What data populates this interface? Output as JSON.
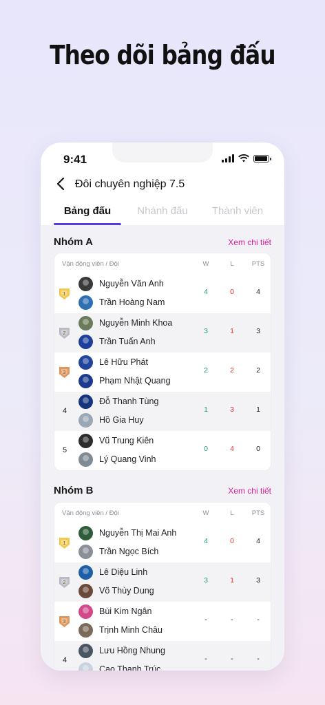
{
  "headline": "Theo dõi bảng đấu",
  "status": {
    "time": "9:41"
  },
  "nav": {
    "title": "Đôi chuyên nghiệp 7.5"
  },
  "tabs": [
    {
      "label": "Bảng đấu",
      "active": true
    },
    {
      "label": "Nhánh đấu",
      "active": false
    },
    {
      "label": "Thành viên",
      "active": false
    }
  ],
  "table_headers": {
    "player": "Vận động viên / Đội",
    "w": "W",
    "l": "L",
    "pts": "PTS"
  },
  "colors": {
    "accent": "#5b3ed8",
    "link": "#d6209a",
    "win": "#1f9c6b",
    "loss": "#e0352b",
    "gold": "#f2c94c",
    "silver": "#b9bcc4",
    "bronze": "#e0955a"
  },
  "groups": [
    {
      "title": "Nhóm A",
      "link": "Xem chi tiết",
      "rows": [
        {
          "rank": "1",
          "medal": "gold",
          "p1": "Nguyễn Văn Anh",
          "p2": "Trần Hoàng Nam",
          "w": "4",
          "l": "0",
          "pts": "4",
          "a1": "#3a3a3a",
          "a2": "#2f6fb3"
        },
        {
          "rank": "2",
          "medal": "silver",
          "p1": "Nguyễn Minh Khoa",
          "p2": "Trần Tuấn Anh",
          "w": "3",
          "l": "1",
          "pts": "3",
          "a1": "#6b7b5b",
          "a2": "#1d3f9a"
        },
        {
          "rank": "3",
          "medal": "bronze",
          "p1": "Lê Hữu Phát",
          "p2": "Phạm Nhật Quang",
          "w": "2",
          "l": "2",
          "pts": "2",
          "a1": "#22449a",
          "a2": "#1c3b8c"
        },
        {
          "rank": "4",
          "medal": "",
          "p1": "Đỗ Thanh Tùng",
          "p2": "Hồ Gia Huy",
          "w": "1",
          "l": "3",
          "pts": "1",
          "a1": "#15357d",
          "a2": "#9aa7b5"
        },
        {
          "rank": "5",
          "medal": "",
          "p1": "Vũ Trung Kiên",
          "p2": "Lý Quang Vinh",
          "w": "0",
          "l": "4",
          "pts": "0",
          "a1": "#2c2c2c",
          "a2": "#7e8a94"
        }
      ]
    },
    {
      "title": "Nhóm B",
      "link": "Xem chi tiết",
      "rows": [
        {
          "rank": "1",
          "medal": "gold",
          "p1": "Nguyễn Thị Mai Anh",
          "p2": "Trần Ngọc Bích",
          "w": "4",
          "l": "0",
          "pts": "4",
          "a1": "#2f5d3a",
          "a2": "#8b8f98"
        },
        {
          "rank": "2",
          "medal": "silver",
          "p1": "Lê Diệu Linh",
          "p2": "Võ Thùy Dung",
          "w": "3",
          "l": "1",
          "pts": "3",
          "a1": "#1e5fa8",
          "a2": "#6a4a3a"
        },
        {
          "rank": "3",
          "medal": "bronze",
          "p1": "Bùi Kim Ngân",
          "p2": "Trịnh Minh Châu",
          "w": "-",
          "l": "-",
          "pts": "-",
          "a1": "#d24a8a",
          "a2": "#7a6a5a"
        },
        {
          "rank": "4",
          "medal": "",
          "p1": "Lưu Hồng Nhung",
          "p2": "Cao Thanh Trúc",
          "w": "-",
          "l": "-",
          "pts": "-",
          "a1": "#4a5563",
          "a2": "#c9d3e0"
        }
      ]
    }
  ]
}
